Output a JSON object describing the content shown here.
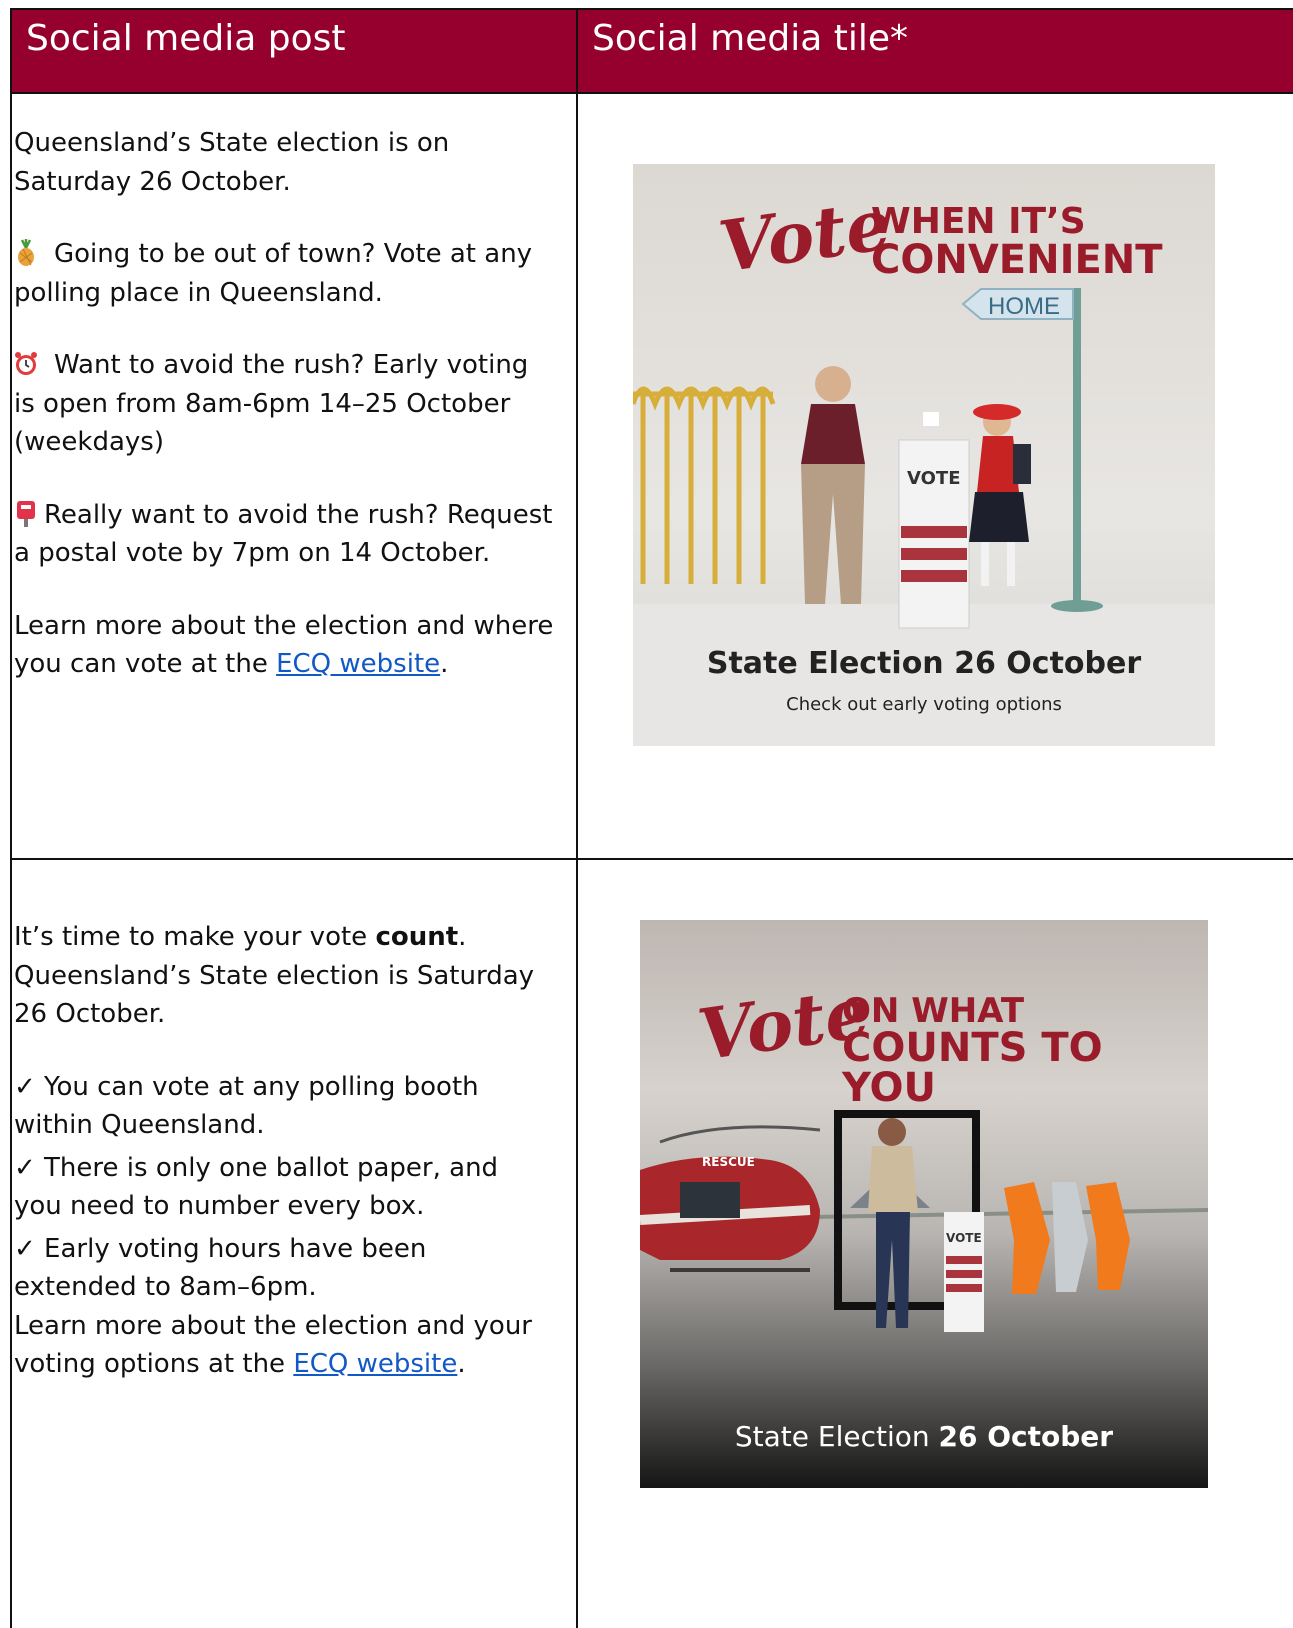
{
  "table": {
    "header_post": "Social media post",
    "header_tile": "Social media tile*"
  },
  "row1": {
    "p1": "Queensland’s State election is on Saturday 26 October.",
    "p2": "Going to be out of town? Vote at any polling place in Queensland.",
    "p3": "Want to avoid the rush? Early voting is open from 8am-6pm 14–25 October (weekdays)",
    "p4": "Really want to avoid the rush? Request a postal vote by 7pm on 14 October.",
    "p5_pre": "Learn more about the election and where you can vote at the ",
    "p5_link": "ECQ website",
    "p5_post": ".",
    "tile": {
      "script": "Vote",
      "headline1": "WHEN IT’S",
      "headline2": "CONVENIENT",
      "sign": "HOME",
      "box": "VOTE",
      "footer": "State Election 26 October",
      "subfooter": "Check out early voting options"
    }
  },
  "row2": {
    "l1_pre": "It’s time to make your vote ",
    "l1_bold": "count",
    "l1_post": ".",
    "l2": "Queensland’s State election is Saturday 26 October.",
    "b1": "✓ You can vote at any polling booth within Queensland.",
    "b2": "✓ There is only one ballot paper, and you need to number every box.",
    "b3": "✓ Early voting hours have been extended to 8am–6pm.",
    "l3_pre": "Learn more about the election and your voting options at the ",
    "l3_link": "ECQ website",
    "l3_post": ".",
    "tile": {
      "script": "Vote",
      "headline1": "ON WHAT",
      "headline2": "COUNTS TO YOU",
      "heli": "RESCUE",
      "box": "VOTE",
      "footer_pre": "State Election ",
      "footer_bold": "26 October"
    }
  },
  "colors": {
    "header_bg": "#96002e",
    "link": "#1159c5",
    "brand_red": "#9a1b2a"
  },
  "icons": [
    "pineapple-icon",
    "alarm-clock-icon",
    "postbox-icon"
  ]
}
